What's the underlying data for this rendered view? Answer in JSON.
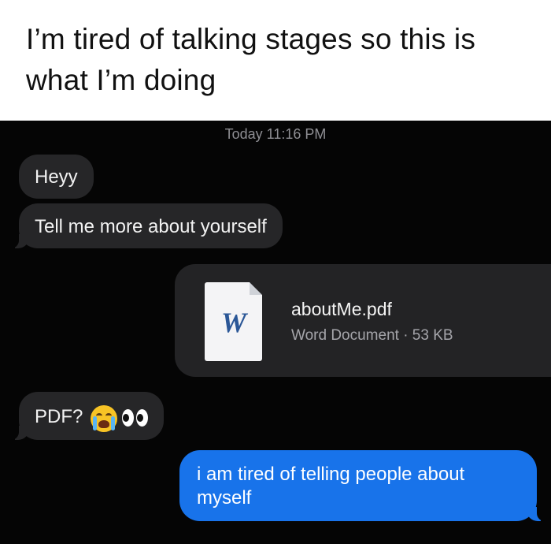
{
  "caption": {
    "text": "I’m tired of talking stages so this is what I’m doing"
  },
  "conversation": {
    "timestamp": "Today 11:16 PM",
    "messages": [
      {
        "sender": "other",
        "type": "text",
        "text": "Heyy"
      },
      {
        "sender": "other",
        "type": "text",
        "text": "Tell me more about yourself"
      },
      {
        "sender": "me",
        "type": "attachment",
        "file_name": "aboutMe.pdf",
        "file_meta": "Word Document · 53 KB",
        "file_icon": "word-document-icon",
        "file_icon_letter": "W"
      },
      {
        "sender": "other",
        "type": "text",
        "text": "PDF?",
        "emojis": [
          "loudly-crying-face-emoji",
          "eyes-emoji"
        ]
      },
      {
        "sender": "me",
        "type": "text",
        "text": "i am tired of telling people about myself"
      }
    ]
  },
  "colors": {
    "chat_background": "#050505",
    "incoming_bubble": "#262628",
    "outgoing_bubble": "#1873ea",
    "timestamp_text": "#8e8e93"
  }
}
